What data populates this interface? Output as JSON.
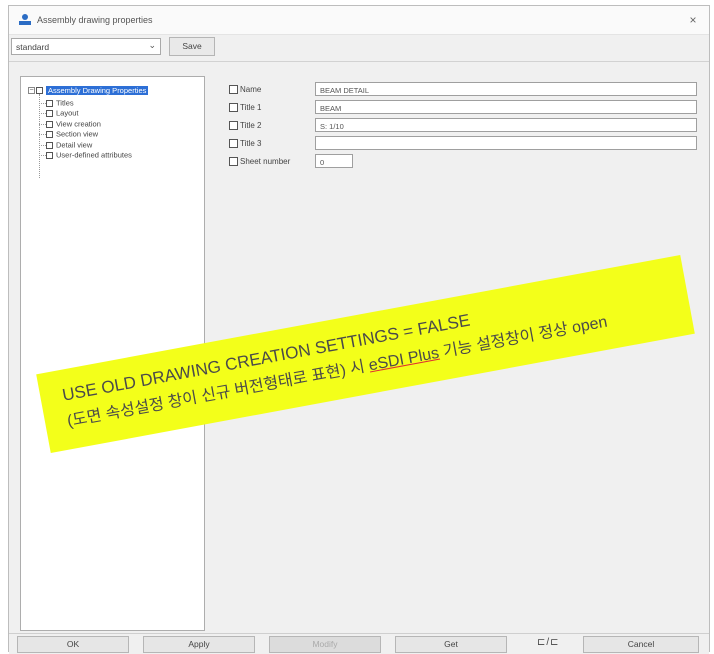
{
  "window": {
    "title": "Assembly drawing properties",
    "close_glyph": "×"
  },
  "toolbar": {
    "preset_value": "standard",
    "dropdown_glyph": "⌄",
    "save_label": "Save"
  },
  "tree": {
    "root_label": "Assembly Drawing Properties",
    "items": [
      "Titles",
      "Layout",
      "View creation",
      "Section view",
      "Detail view",
      "User-defined attributes"
    ]
  },
  "properties": {
    "rows": [
      {
        "label": "Name",
        "value": "BEAM DETAIL"
      },
      {
        "label": "Title 1",
        "value": "BEAM"
      },
      {
        "label": "Title 2",
        "value": "S: 1/10"
      },
      {
        "label": "Title 3",
        "value": ""
      },
      {
        "label": "Sheet number",
        "value": "0"
      }
    ]
  },
  "annotation": {
    "line1": "USE OLD DRAWING CREATION SETTINGS = FALSE",
    "line2_prefix": "(도면 속성설정 창이 신규 버전형태로 표현) 시 ",
    "line2_underlined": "eSDI Plus",
    "line2_suffix": " 기능 설정창이 정상 open",
    "color": "#f3ff1a"
  },
  "buttons": {
    "ok": "OK",
    "apply": "Apply",
    "modify": "Modify",
    "get": "Get",
    "toggle": "⊏/⊏",
    "cancel": "Cancel"
  },
  "icons": {
    "app": "assembly-icon",
    "close": "close-icon",
    "dropdown": "chevron-down-icon",
    "toggle": "toggle-checkbox-icon"
  }
}
